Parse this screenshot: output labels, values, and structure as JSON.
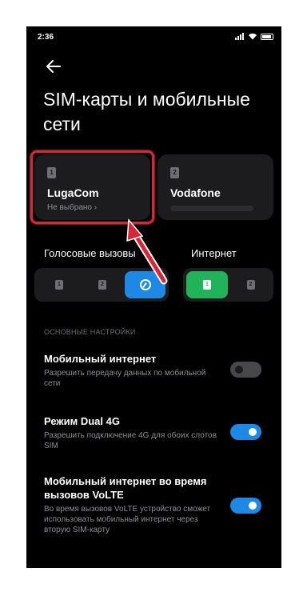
{
  "status": {
    "time": "2:36"
  },
  "header": {
    "title": "SIM-карты и мобильные сети"
  },
  "sims": [
    {
      "slot": "1",
      "name": "LugaCom",
      "subtitle": "Не выбрано ›"
    },
    {
      "slot": "2",
      "name": "Vodafone"
    }
  ],
  "voice": {
    "label": "Голосовые вызовы",
    "options": [
      "1",
      "2"
    ],
    "selected": "ask"
  },
  "internet": {
    "label": "Интернет",
    "options": [
      "1",
      "2"
    ],
    "selected": "1"
  },
  "settings": {
    "group_header": "ОСНОВНЫЕ НАСТРОЙКИ",
    "items": [
      {
        "title": "Мобильный интернет",
        "desc": "Разрешить передачу данных по мобильной сети",
        "enabled": false
      },
      {
        "title": "Режим Dual 4G",
        "desc": "Разрешить подключение 4G для обоих слотов SIM",
        "enabled": true
      },
      {
        "title": "Мобильный интернет во время вызовов VoLTE",
        "desc": "Во время вызовов VoLTE устройство сможет использовать мобильный интернет через вторую SIM-карту",
        "enabled": true
      }
    ]
  },
  "colors": {
    "accent": "#1e88e5",
    "internet_accent": "#21b35a",
    "annotation": "#d72638"
  }
}
